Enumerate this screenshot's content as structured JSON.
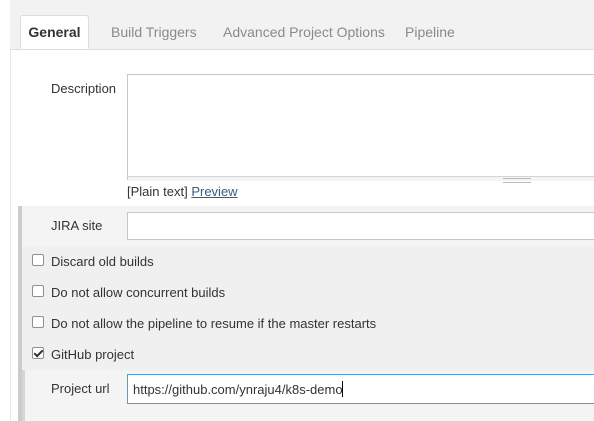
{
  "tabs": [
    {
      "label": "General",
      "active": true
    },
    {
      "label": "Build Triggers",
      "active": false
    },
    {
      "label": "Advanced Project Options",
      "active": false
    },
    {
      "label": "Pipeline",
      "active": false
    }
  ],
  "description": {
    "label": "Description",
    "value": "",
    "format_note": "[Plain text]",
    "preview_link": "Preview"
  },
  "jira": {
    "label": "JIRA site",
    "value": ""
  },
  "options": [
    {
      "label": "Discard old builds",
      "checked": false
    },
    {
      "label": "Do not allow concurrent builds",
      "checked": false
    },
    {
      "label": "Do not allow the pipeline to resume if the master restarts",
      "checked": false
    },
    {
      "label": "GitHub project",
      "checked": true
    }
  ],
  "github": {
    "project_url_label": "Project url",
    "project_url_value": "https://github.com/ynraju4/k8s-demo"
  },
  "icons": {
    "checkmark": "check-icon",
    "resize_grip": "resize-grip-icon"
  },
  "colors": {
    "link": "#2f5c94",
    "focus_border": "#5b9bd5",
    "band_border": "#cccccc"
  }
}
